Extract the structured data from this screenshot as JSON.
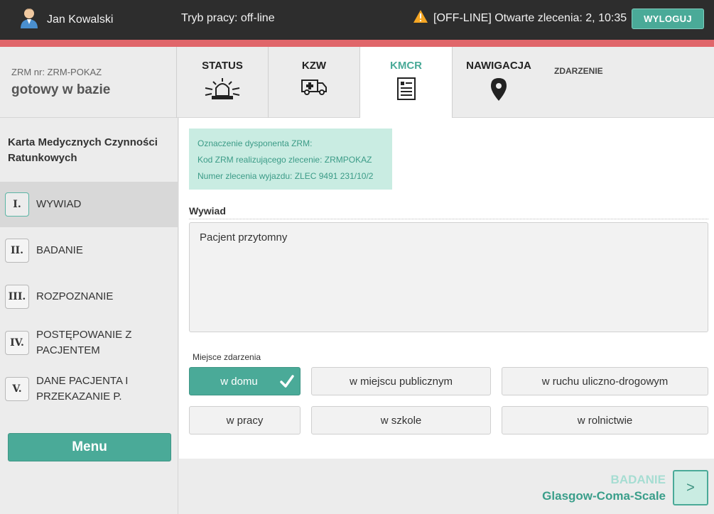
{
  "topbar": {
    "user_name": "Jan Kowalski",
    "mode": "Tryb pracy: off-line",
    "status_text": "[OFF-LINE] Otwarte zlecenia: 2, 10:35",
    "logout_label": "WYLOGUJ"
  },
  "header": {
    "zrm_nr": "ZRM nr: ZRM-POKAZ",
    "zrm_state": "gotowy w bazie",
    "tabs": [
      {
        "label": "STATUS",
        "icon": "siren-icon"
      },
      {
        "label": "KZW",
        "icon": "ambulance-icon"
      },
      {
        "label": "KMCR",
        "icon": "document-icon",
        "active": true
      },
      {
        "label": "NAWIGACJA",
        "icon": "location-pin-icon"
      }
    ],
    "zdarzenie_label": "ZDARZENIE"
  },
  "sidebar": {
    "title": "Karta Medycznych Czynności Ratunkowych",
    "items": [
      {
        "num": "I.",
        "label": "WYWIAD",
        "active": true
      },
      {
        "num": "II.",
        "label": "BADANIE"
      },
      {
        "num": "III.",
        "label": "ROZPOZNANIE"
      },
      {
        "num": "IV.",
        "label": "POSTĘPOWANIE Z PACJENTEM"
      },
      {
        "num": "V.",
        "label": "DANE PACJENTA I PRZEKAZANIE P."
      }
    ],
    "menu_label": "Menu"
  },
  "info": {
    "line1": "Oznaczenie dysponenta ZRM:",
    "line2": "Kod ZRM realizującego zlecenie: ZRMPOKAZ",
    "line3": "Numer zlecenia wyjazdu: ZLEC 9491 231/10/2"
  },
  "wywiad": {
    "title": "Wywiad",
    "value": "Pacjent przytomny"
  },
  "place": {
    "label": "Miejsce zdarzenia",
    "options": [
      {
        "label": "w domu",
        "selected": true
      },
      {
        "label": "w miejscu publicznym"
      },
      {
        "label": "w ruchu uliczno-drogowym"
      },
      {
        "label": "w pracy"
      },
      {
        "label": "w szkole"
      },
      {
        "label": "w rolnictwie"
      }
    ]
  },
  "next": {
    "category": "BADANIE",
    "name": "Glasgow-Coma-Scale",
    "button_label": ">"
  },
  "colors": {
    "accent": "#4aaa98",
    "topbar": "#2d2d2d",
    "alert_line": "#e0666a",
    "info_bg": "#c9ece2"
  }
}
